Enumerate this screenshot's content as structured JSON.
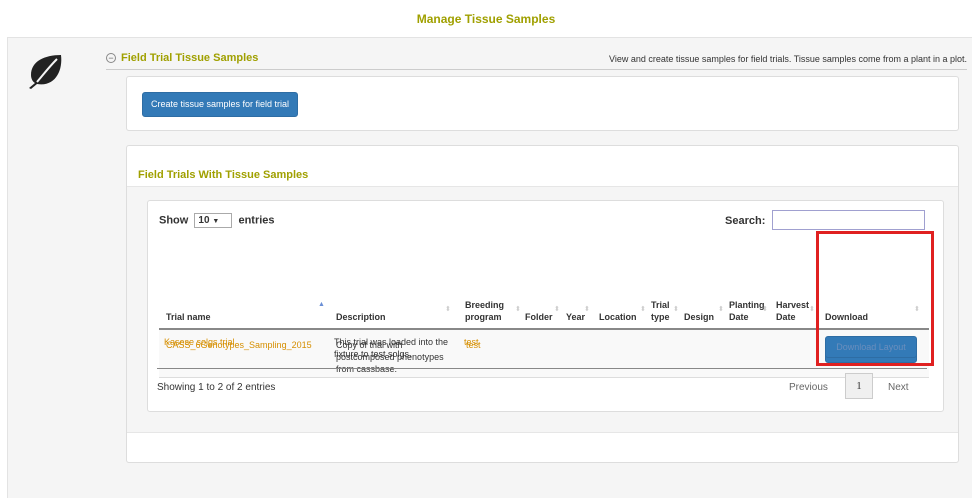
{
  "header": {
    "title": "Manage Tissue Samples"
  },
  "section": {
    "toggle": "−",
    "title": "Field Trial Tissue Samples",
    "description": "View and create tissue samples for field trials. Tissue samples come from a plant in a plot."
  },
  "create_button": "Create tissue samples for field trial",
  "trials_panel": {
    "title": "Field Trials With Tissue Samples",
    "show_label": "Show",
    "entries_value": "10",
    "entries_label": "entries",
    "search_label": "Search:",
    "search_value": ""
  },
  "table": {
    "columns": {
      "trial_name": "Trial name",
      "description": "Description",
      "breeding_program": "Breeding program",
      "folder": "Folder",
      "year": "Year",
      "location": "Location",
      "trial_type": "Trial type",
      "design": "Design",
      "planting_date": "Planting Date",
      "harvest_date": "Harvest Date",
      "download": "Download"
    },
    "rows": [
      {
        "trial_name": "CASS_6Genotypes_Sampling_2015",
        "description": "Copy of trial with postcomposed phenotypes from cassbase.",
        "breeding_program": "test",
        "download_label": "Download Layout"
      },
      {
        "trial_name": "Kasese solgs trial",
        "description": "This trial was loaded into the fixture to test solgs.",
        "breeding_program": "test",
        "download_label": "Download Layout"
      }
    ]
  },
  "footer": {
    "showing": "Showing 1 to 2 of 2 entries",
    "previous": "Previous",
    "current_page": "1",
    "next": "Next"
  },
  "colors": {
    "accent": "#a0a000",
    "link": "#d68f00",
    "button": "#337ab7",
    "highlight": "#e02020"
  }
}
